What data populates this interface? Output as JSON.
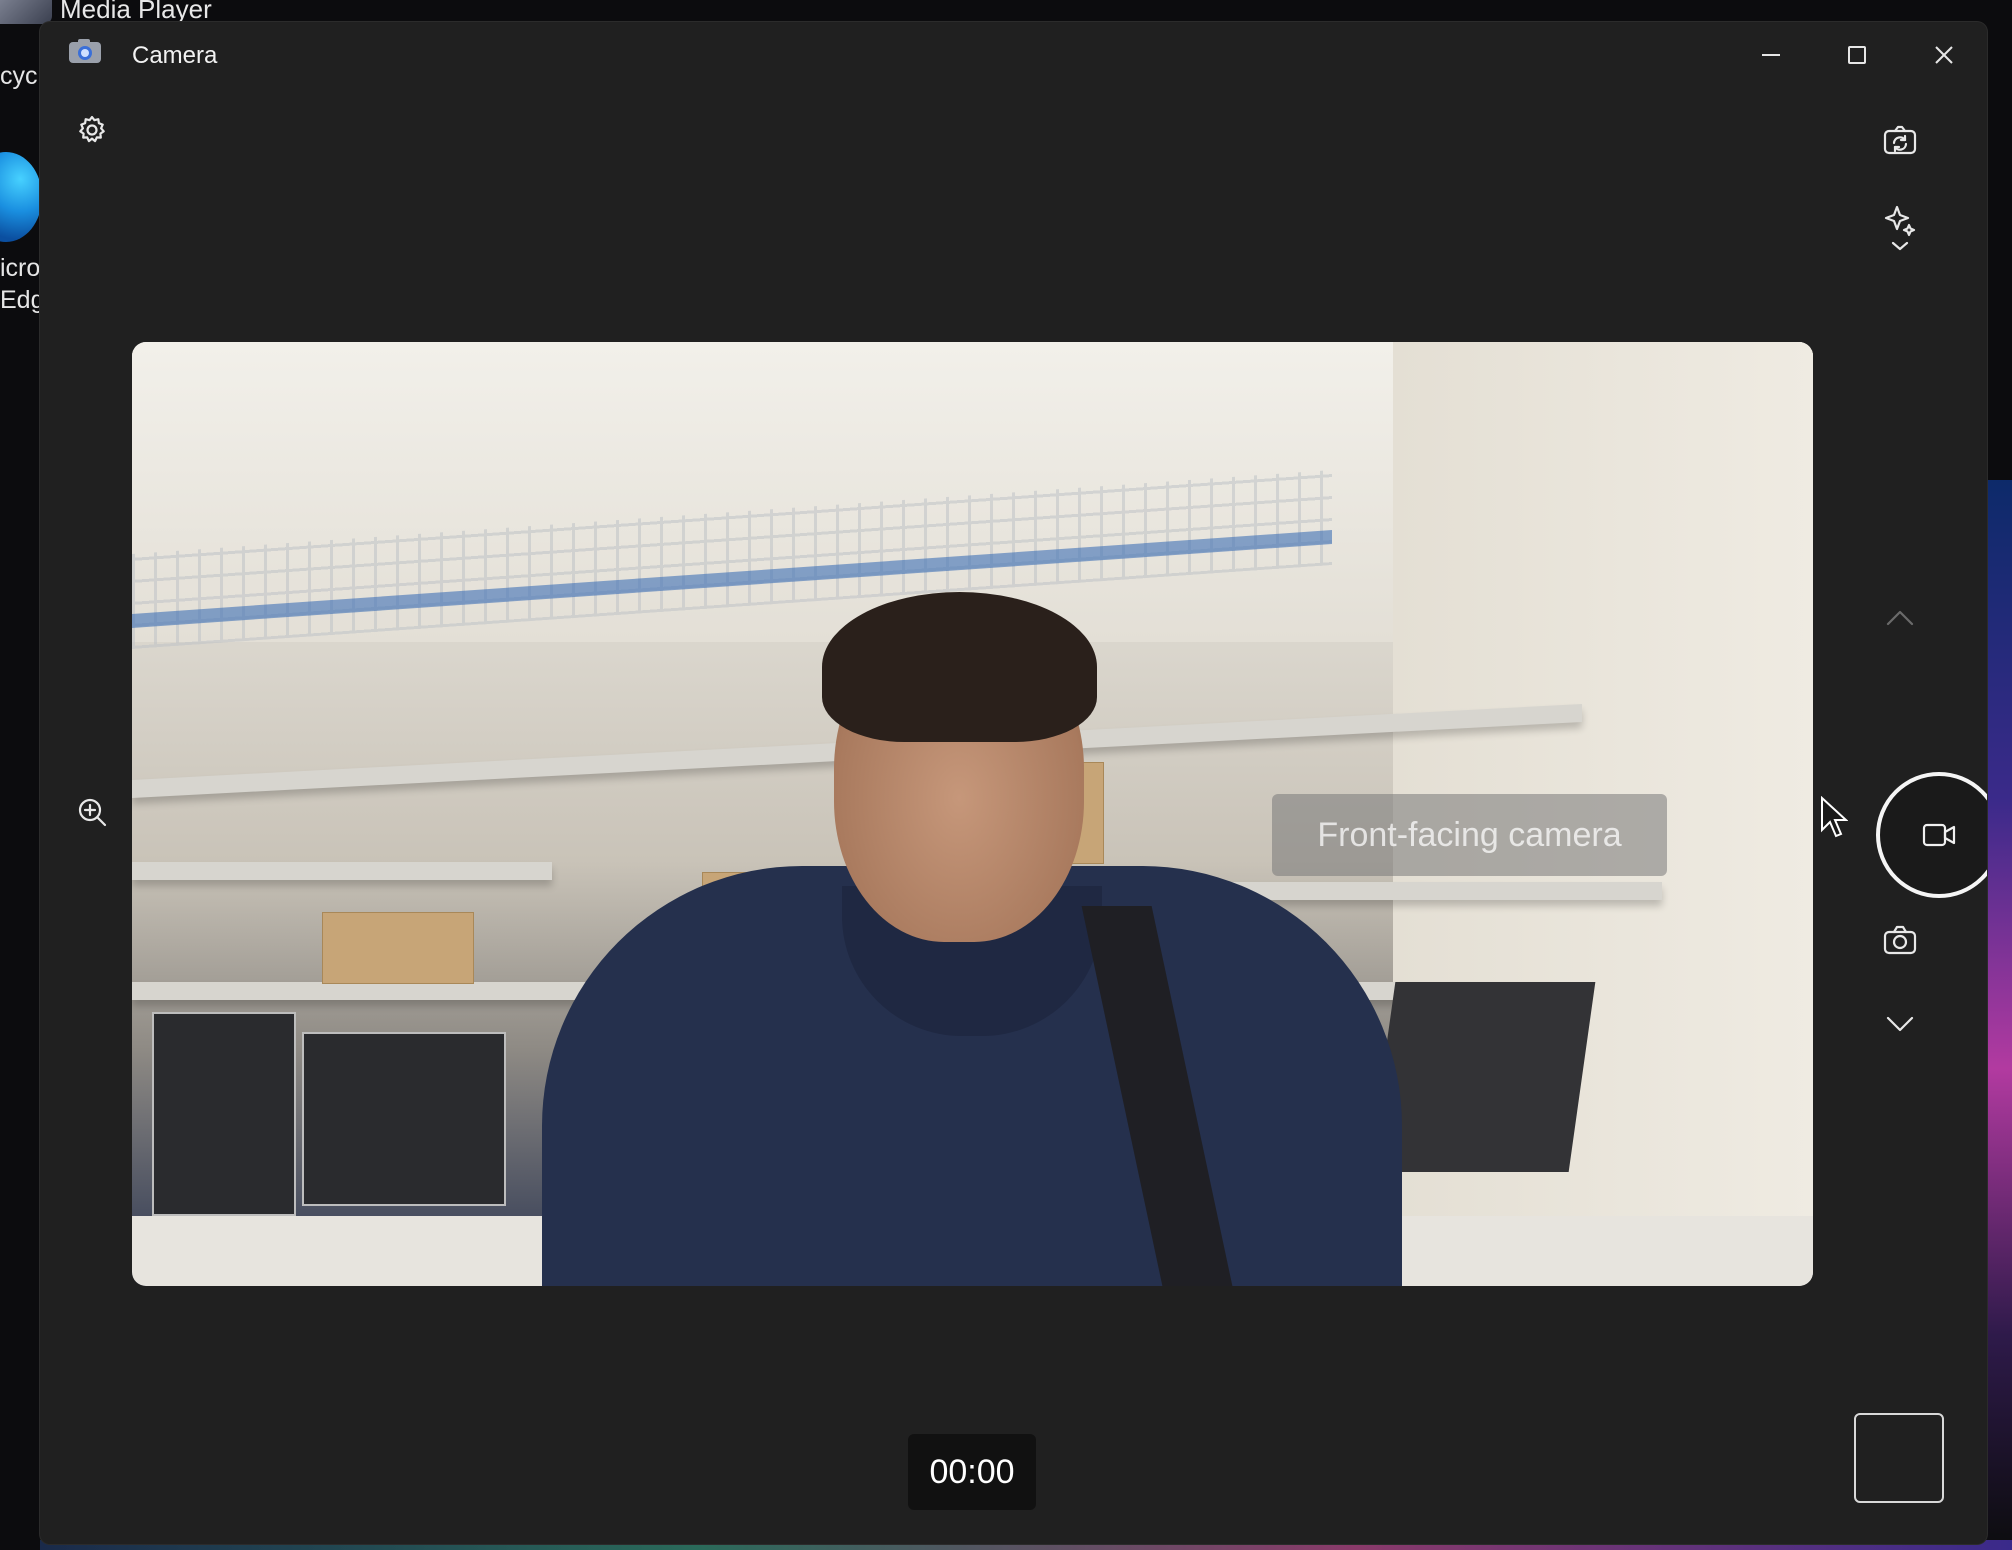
{
  "desktop": {
    "top_title": "Media Player",
    "icon_labels": [
      "cycle",
      "icros",
      "Edg"
    ]
  },
  "window": {
    "title": "Camera",
    "minimize_label": "Minimize",
    "maximize_label": "Maximize",
    "close_label": "Close"
  },
  "camera": {
    "overlay_text": "Front-facing camera",
    "timer": "00:00",
    "mode": "video"
  },
  "icons": {
    "settings": "gear-icon",
    "switch_camera": "switch-camera-icon",
    "effects": "sparkle-icon",
    "zoom": "zoom-in-icon",
    "mode_up": "chevron-up-icon",
    "mode_down": "chevron-down-icon",
    "video": "video-icon",
    "photo": "camera-icon"
  },
  "colors": {
    "window_bg": "#202020",
    "accent": "#f5f5f5"
  }
}
